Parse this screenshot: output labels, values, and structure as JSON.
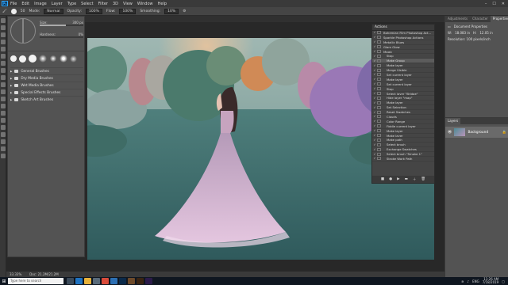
{
  "menubar": {
    "logo": "Ps",
    "items": [
      "File",
      "Edit",
      "Image",
      "Layer",
      "Type",
      "Select",
      "Filter",
      "3D",
      "View",
      "Window",
      "Help"
    ],
    "window_controls": [
      "–",
      "☐",
      "✕"
    ]
  },
  "options": {
    "mode_label": "Mode:",
    "mode_value": "Normal",
    "opacity_label": "Opacity:",
    "opacity_value": "100%",
    "flow_label": "Flow:",
    "flow_value": "100%",
    "smoothing_label": "Smoothing:",
    "smoothing_value": "10%",
    "size_value": "50"
  },
  "brush_panel": {
    "size_label": "Size:",
    "size_value": "300 px",
    "hardness_label": "Hardness:",
    "hardness_value": "0%",
    "size_fraction": 0.6,
    "hardness_fraction": 0.0,
    "folders": [
      "General Brushes",
      "Dry Media Brushes",
      "Wet Media Brushes",
      "Special Effects Brushes",
      "Sketch Art Brushes"
    ]
  },
  "actions_panel": {
    "title": "Actions",
    "rows": [
      {
        "label": "Bohemian Film Photoshop Act...",
        "sel": false
      },
      {
        "label": "Sparkle Photoshop Actions",
        "sel": false
      },
      {
        "label": "Metallic Blues",
        "sel": false
      },
      {
        "label": "Glam Glow",
        "sel": false
      },
      {
        "label": "Magic",
        "sel": false
      },
      {
        "label": "Stop",
        "sel": false
      },
      {
        "label": "Make Group",
        "sel": true
      },
      {
        "label": "Make layer",
        "sel": false
      },
      {
        "label": "Merge Visible",
        "sel": false
      },
      {
        "label": "Set current layer",
        "sel": false
      },
      {
        "label": "Make layer",
        "sel": false
      },
      {
        "label": "Set current layer",
        "sel": false
      },
      {
        "label": "Stop",
        "sel": false
      },
      {
        "label": "Select layer \"Bridge\"",
        "sel": false
      },
      {
        "label": "Hide layer \"map\"",
        "sel": false
      },
      {
        "label": "Make layer",
        "sel": false
      },
      {
        "label": "Set Selection",
        "sel": false
      },
      {
        "label": "Reset Swatches",
        "sel": false
      },
      {
        "label": "Clouds",
        "sel": false
      },
      {
        "label": "Color Range",
        "sel": false
      },
      {
        "label": "Fiddle current layer",
        "sel": false
      },
      {
        "label": "Make layer",
        "sel": false
      },
      {
        "label": "Make layer",
        "sel": false
      },
      {
        "label": "Make path",
        "sel": false
      },
      {
        "label": "Select brush",
        "sel": false
      },
      {
        "label": "Exchange Swatches",
        "sel": false
      },
      {
        "label": "Select brush \"Smoke 1\"",
        "sel": false
      },
      {
        "label": "Stroke Work Path",
        "sel": false
      }
    ],
    "footer_buttons": [
      "■",
      "●",
      "▶",
      "▬",
      "＋",
      "🗑"
    ]
  },
  "right_panel": {
    "tabs": [
      "Adjustments",
      "Character",
      "Properties"
    ],
    "active_tab": "Properties",
    "properties_title": "Document Properties",
    "w_label": "W:",
    "w_value": "18.083 in",
    "h_label": "H:",
    "h_value": "12.05 in",
    "resolution": "Resolution: 100 pixels/inch",
    "layers_tab": "Layers",
    "layer_name": "Background"
  },
  "status": {
    "zoom": "33.33%",
    "doc": "Doc: 21.2M/21.2M"
  },
  "taskbar": {
    "search_placeholder": "Type here to search",
    "language": "ENG",
    "time": "11:26 AM",
    "date": "7/18/2019",
    "apps": [
      {
        "name": "task-view",
        "color": "#3b4a5a"
      },
      {
        "name": "edge",
        "color": "#1f73c2"
      },
      {
        "name": "explorer",
        "color": "#e8b23a"
      },
      {
        "name": "store",
        "color": "#5a6b7a"
      },
      {
        "name": "chrome",
        "color": "#d94b3a"
      },
      {
        "name": "mail",
        "color": "#2c6fb3"
      },
      {
        "name": "photoshop",
        "color": "#0b2a4a"
      },
      {
        "name": "bridge",
        "color": "#6e4a2a"
      },
      {
        "name": "illustrator",
        "color": "#3a2412"
      },
      {
        "name": "premiere",
        "color": "#2b1b4a"
      }
    ]
  }
}
